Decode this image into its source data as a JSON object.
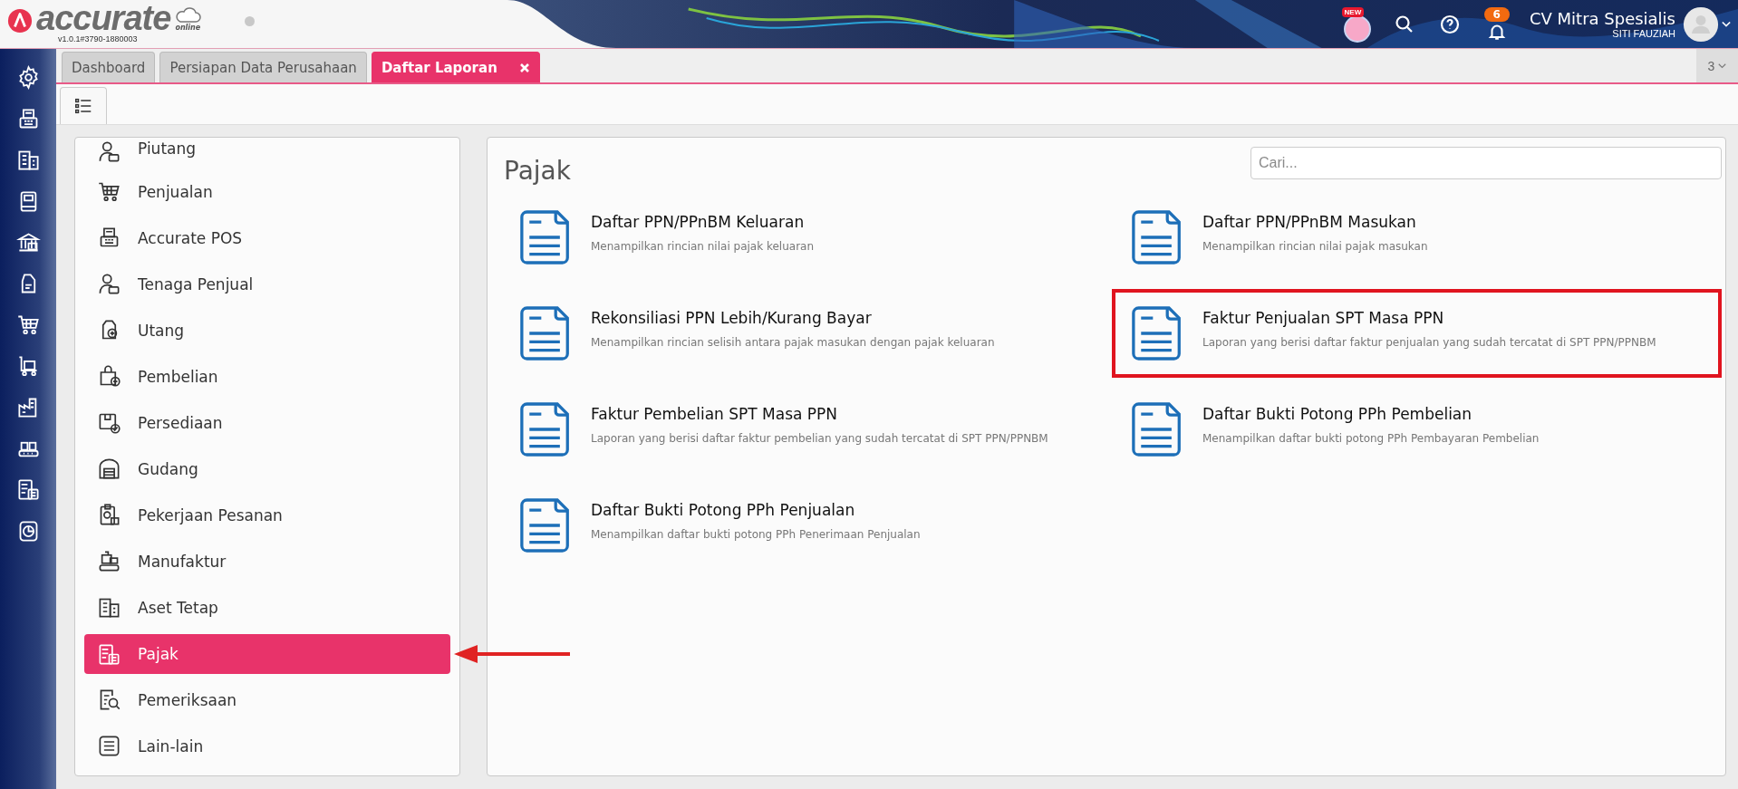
{
  "header": {
    "brand": "accurate",
    "brand_sub": "online",
    "version": "v1.0.1#3790-1880003",
    "new_badge": "NEW",
    "notification_count": "6",
    "company": "CV Mitra Spesialis",
    "user": "SITI FAUZIAH"
  },
  "tabs": [
    {
      "label": "Dashboard",
      "selected": false,
      "closable": false
    },
    {
      "label": "Persiapan Data Perusahaan",
      "selected": false,
      "closable": false
    },
    {
      "label": "Daftar Laporan",
      "selected": true,
      "closable": true
    }
  ],
  "tab_count": "3",
  "sidebar": {
    "items": [
      {
        "label": "Piutang",
        "selected": false,
        "pointed": false
      },
      {
        "label": "Penjualan",
        "selected": false,
        "pointed": false
      },
      {
        "label": "Accurate POS",
        "selected": false,
        "pointed": false
      },
      {
        "label": "Tenaga Penjual",
        "selected": false,
        "pointed": false
      },
      {
        "label": "Utang",
        "selected": false,
        "pointed": false
      },
      {
        "label": "Pembelian",
        "selected": false,
        "pointed": false
      },
      {
        "label": "Persediaan",
        "selected": false,
        "pointed": false
      },
      {
        "label": "Gudang",
        "selected": false,
        "pointed": false
      },
      {
        "label": "Pekerjaan Pesanan",
        "selected": false,
        "pointed": false
      },
      {
        "label": "Manufaktur",
        "selected": false,
        "pointed": false
      },
      {
        "label": "Aset Tetap",
        "selected": false,
        "pointed": false
      },
      {
        "label": "Pajak",
        "selected": true,
        "pointed": true
      },
      {
        "label": "Pemeriksaan",
        "selected": false,
        "pointed": false
      },
      {
        "label": "Lain-lain",
        "selected": false,
        "pointed": false
      }
    ]
  },
  "panel": {
    "title": "Pajak",
    "search": {
      "placeholder": "Cari..."
    },
    "reports": [
      {
        "title": "Daftar PPN/PPnBM Keluaran",
        "description": "Menampilkan rincian nilai pajak keluaran",
        "highlighted": false
      },
      {
        "title": "Daftar PPN/PPnBM Masukan",
        "description": "Menampilkan rincian nilai pajak masukan",
        "highlighted": false
      },
      {
        "title": "Rekonsiliasi PPN Lebih/Kurang Bayar",
        "description": "Menampilkan rincian selisih antara pajak masukan dengan pajak keluaran",
        "highlighted": false
      },
      {
        "title": "Faktur Penjualan SPT Masa PPN",
        "description": "Laporan yang berisi daftar faktur penjualan yang sudah tercatat di SPT PPN/PPNBM",
        "highlighted": true
      },
      {
        "title": "Faktur Pembelian SPT Masa PPN",
        "description": "Laporan yang berisi daftar faktur pembelian yang sudah tercatat di SPT PPN/PPNBM",
        "highlighted": false
      },
      {
        "title": "Daftar Bukti Potong PPh Pembelian",
        "description": "Menampilkan daftar bukti potong PPh Pembayaran Pembelian",
        "highlighted": false
      },
      {
        "title": "Daftar Bukti Potong PPh Penjualan",
        "description": "Menampilkan daftar bukti potong PPh Penerimaan Penjualan",
        "highlighted": false
      }
    ]
  }
}
